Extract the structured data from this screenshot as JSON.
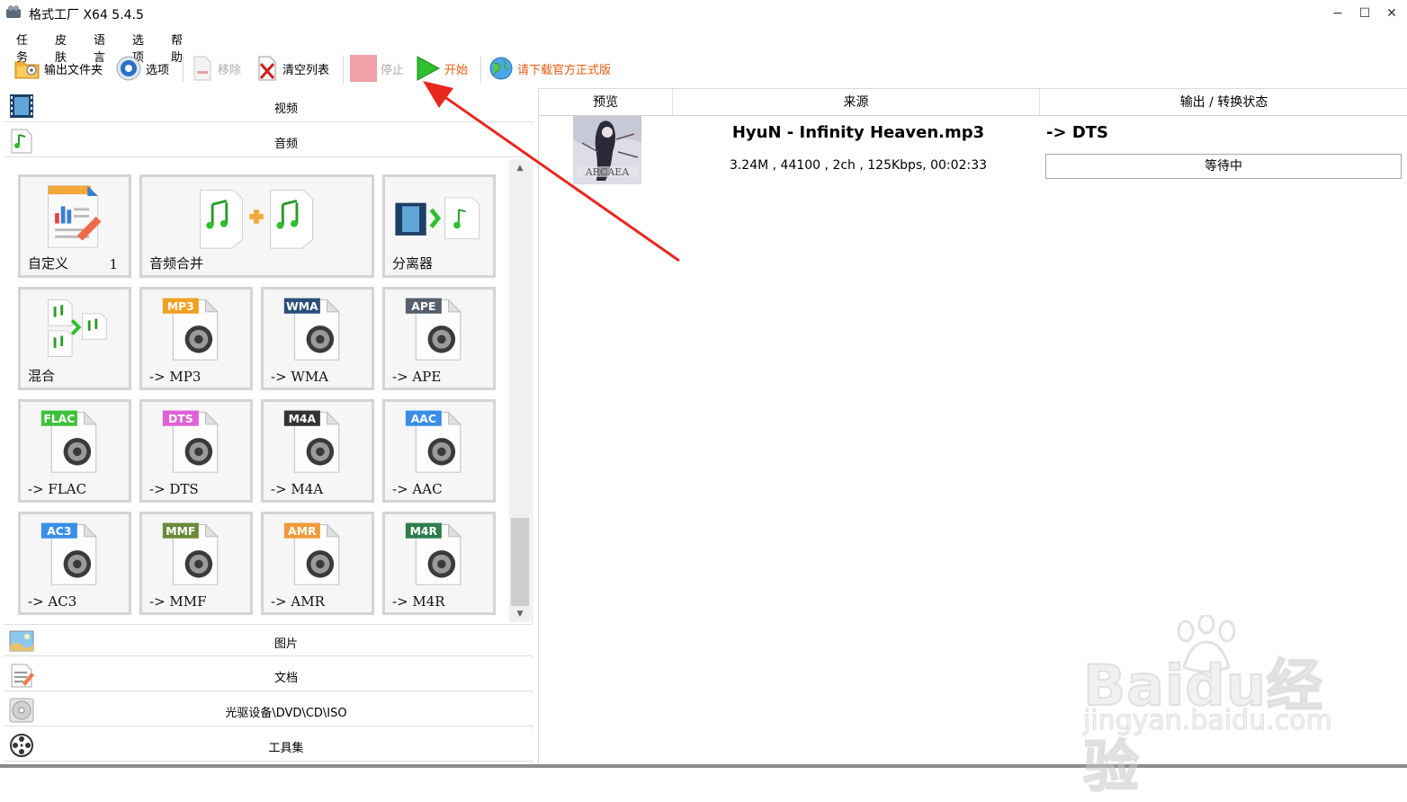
{
  "window": {
    "title": "格式工厂 X64 5.4.5",
    "minimize": "−",
    "maximize": "☐",
    "close": "✕"
  },
  "menu": [
    "任务",
    "皮肤",
    "语言",
    "选项",
    "帮助"
  ],
  "toolbar": {
    "output_folder": "输出文件夹",
    "options": "选项",
    "remove": "移除",
    "clear_list": "清空列表",
    "stop": "停止",
    "start": "开始",
    "download": "请下载官方正式版",
    "accent_start": "#e8580c",
    "accent_download": "#e8580c"
  },
  "categories": {
    "video": "视频",
    "audio": "音频",
    "picture": "图片",
    "document": "文档",
    "disc": "光驱设备\\DVD\\CD\\ISO",
    "tools": "工具集"
  },
  "tiles": {
    "custom": {
      "label": "自定义",
      "count": "1"
    },
    "merge": {
      "label": "音频合并"
    },
    "splitter": {
      "label": "分离器"
    },
    "mix": {
      "label": "混合"
    },
    "formats": [
      {
        "badge": "MP3",
        "label": "-> MP3",
        "color": "#f0a020"
      },
      {
        "badge": "WMA",
        "label": "-> WMA",
        "color": "#2b4f7a"
      },
      {
        "badge": "APE",
        "label": "-> APE",
        "color": "#55606c"
      },
      {
        "badge": "FLAC",
        "label": "-> FLAC",
        "color": "#3cc23c"
      },
      {
        "badge": "DTS",
        "label": "-> DTS",
        "color": "#e060d8"
      },
      {
        "badge": "M4A",
        "label": "-> M4A",
        "color": "#333333"
      },
      {
        "badge": "AAC",
        "label": "-> AAC",
        "color": "#3a8ee6"
      },
      {
        "badge": "AC3",
        "label": "-> AC3",
        "color": "#3a8ee6"
      },
      {
        "badge": "MMF",
        "label": "-> MMF",
        "color": "#6a8a3a"
      },
      {
        "badge": "AMR",
        "label": "-> AMR",
        "color": "#f09a3a"
      },
      {
        "badge": "M4R",
        "label": "-> M4R",
        "color": "#2e7d4f"
      }
    ]
  },
  "list": {
    "columns": [
      "预览",
      "来源",
      "输出 / 转换状态"
    ],
    "rows": [
      {
        "file_name": "HyuN - Infinity Heaven.mp3",
        "meta": "3.24M , 44100 , 2ch , 125Kbps, 00:02:33",
        "output": "-> DTS",
        "status": "等待中"
      }
    ]
  },
  "watermark": {
    "brand": "Baidu经验",
    "url": "jingyan.baidu.com"
  }
}
